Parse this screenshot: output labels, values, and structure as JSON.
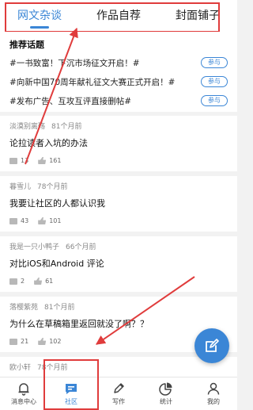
{
  "tabs": [
    {
      "label": "网文杂谈",
      "active": true
    },
    {
      "label": "作品自荐",
      "active": false
    },
    {
      "label": "封面铺子",
      "active": false
    }
  ],
  "topics": {
    "title": "推荐话题",
    "join_label": "参与",
    "items": [
      "#一书致富！下沉市场征文开启！#",
      "#向新中国70周年献礼征文大赛正式开启！#",
      "#发布广告、互攻互评直接删帖#"
    ]
  },
  "posts": [
    {
      "author": "淡漠别离殇",
      "time": "81个月前",
      "title": "论拉读者入坑的办法",
      "comments": "13",
      "likes": "161"
    },
    {
      "author": "暮雪儿",
      "time": "78个月前",
      "title": "我要让社区的人都认识我",
      "comments": "43",
      "likes": "101"
    },
    {
      "author": "我是一只小鸭子",
      "time": "66个月前",
      "title": "对比iOS和Android 评论",
      "comments": "2",
      "likes": "61"
    },
    {
      "author": "落樱紫苑",
      "time": "81个月前",
      "title": "为什么在草稿箱里返回就没了啊？？",
      "comments": "21",
      "likes": "102"
    },
    {
      "author": "欧小轩",
      "time": "78个月前",
      "title": "",
      "comments": "",
      "likes": ""
    }
  ],
  "nav": [
    {
      "label": "消息中心",
      "icon": "bell-icon",
      "active": false
    },
    {
      "label": "社区",
      "icon": "chat-icon",
      "active": true
    },
    {
      "label": "写作",
      "icon": "pen-icon",
      "active": false
    },
    {
      "label": "统计",
      "icon": "pie-chart-icon",
      "active": false
    },
    {
      "label": "我的",
      "icon": "user-icon",
      "active": false
    }
  ],
  "colors": {
    "accent": "#3b86d6",
    "annotation": "#e03c3c"
  }
}
